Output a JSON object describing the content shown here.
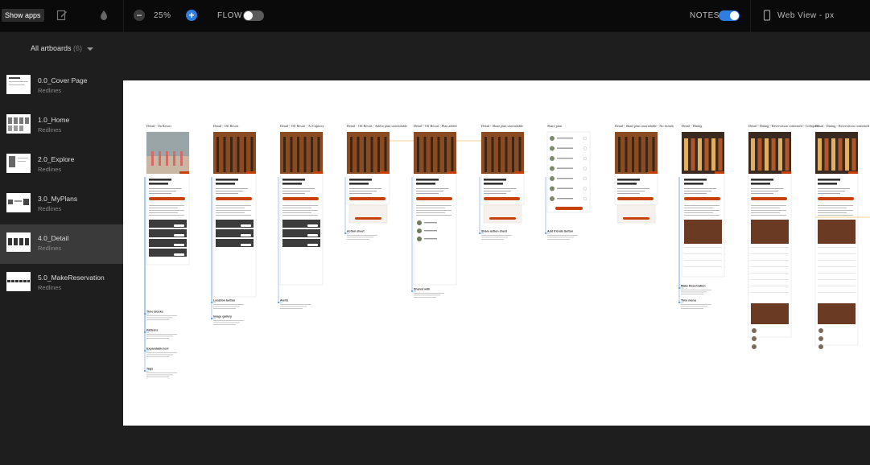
{
  "toolbar": {
    "show_apps": "Show apps",
    "zoom_minus": "−",
    "zoom_value": "25%",
    "zoom_plus": "+",
    "flow_label": "FLOW",
    "flow_on": false,
    "notes_label": "NOTES",
    "notes_on": true,
    "view_label": "Web View - px"
  },
  "sidebar": {
    "header": "All artboards",
    "header_count": "(6)",
    "items": [
      {
        "name": "0.0_Cover Page",
        "sub": "Redlines"
      },
      {
        "name": "1.0_Home",
        "sub": "Redlines"
      },
      {
        "name": "2.0_Explore",
        "sub": "Redlines"
      },
      {
        "name": "3.0_MyPlans",
        "sub": "Redlines"
      },
      {
        "name": "4.0_Detail",
        "sub": "Redlines"
      },
      {
        "name": "5.0_MakeReservation",
        "sub": "Redlines"
      }
    ],
    "active_index": 4
  },
  "artboards": [
    {
      "title": "Detail - On Resort"
    },
    {
      "title": "Detail - Off Resort"
    },
    {
      "title": "Detail - Off Resort - At Capacity"
    },
    {
      "title": "Detail - Off Resort - Add to plan unavailable"
    },
    {
      "title": "Detail - Off Resort - Plan added"
    },
    {
      "title": "Detail - Share plan unavailable"
    },
    {
      "title": "Share plan"
    },
    {
      "title": "Detail - Share plan unavailable - No friends"
    },
    {
      "title": "Detail - Dining"
    },
    {
      "title": "Detail - Dining - Reservation confirmed - Collapsed"
    },
    {
      "title": "Detail - Dining - Reservation confirmed - Expanded"
    }
  ],
  "notes": [
    {
      "title": "Time blocks"
    },
    {
      "title": "Patterns"
    },
    {
      "title": "Expandable text"
    },
    {
      "title": "Tags"
    },
    {
      "title": "Location button"
    },
    {
      "title": "Image gallery"
    },
    {
      "title": "Alerts"
    },
    {
      "title": "Action sheet"
    },
    {
      "title": "Shared with"
    },
    {
      "title": "Share action sheet"
    },
    {
      "title": "Add friends button"
    },
    {
      "title": "Make Reservation"
    },
    {
      "title": "Time menu"
    }
  ],
  "colors": {
    "accent": "#c8410a",
    "toggle_on": "#2f7de1",
    "note_line": "#4a90d9",
    "flow_line": "#f5a623"
  }
}
